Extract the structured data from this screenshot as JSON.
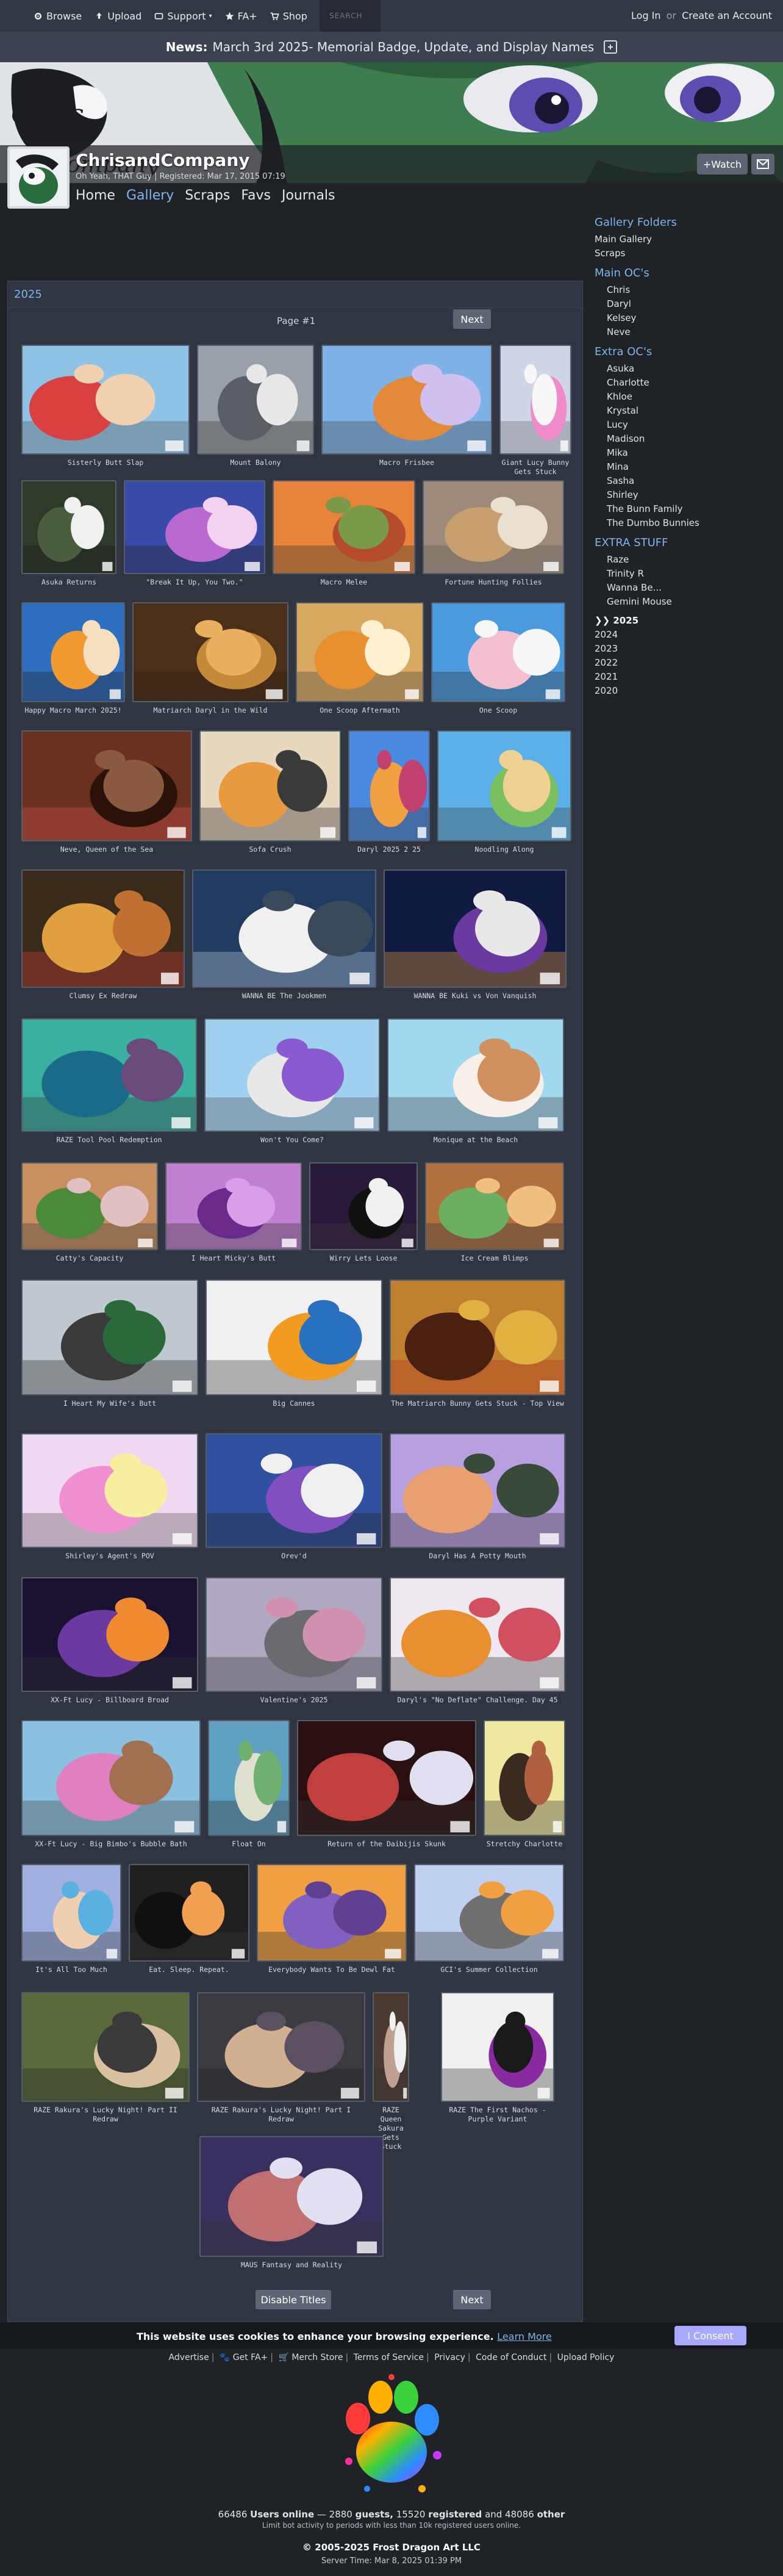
{
  "topbar": {
    "browse": "Browse",
    "upload": "Upload",
    "support": "Support",
    "fa_plus": "FA+",
    "shop": "Shop",
    "search_placeholder": "SEARCH",
    "login": "Log In",
    "or": "or",
    "create_account": "Create an Account"
  },
  "news": {
    "label": "News:",
    "text": "March 3rd 2025- Memorial Badge, Update, and Display Names"
  },
  "profile": {
    "username": "ChrisandCompany",
    "meta": "Oh Yeah, THAT Guy | Registered: Mar 17, 2015 07:19",
    "watch_label": "+Watch",
    "tabs": [
      "Home",
      "Gallery",
      "Scraps",
      "Favs",
      "Journals"
    ]
  },
  "sidebar": {
    "heading_folders": "Gallery Folders",
    "top_links": [
      "Main Gallery",
      "Scraps"
    ],
    "sections": [
      {
        "title": "Main OC's",
        "items": [
          "Chris",
          "Daryl",
          "Kelsey",
          "Neve"
        ]
      },
      {
        "title": "Extra OC's",
        "items": [
          "Asuka",
          "Charlotte",
          "Khloe",
          "Krystal",
          "Lucy",
          "Madison",
          "Mika",
          "Mina",
          "Sasha",
          "Shirley",
          "The Bunn Family",
          "The Dumbo Bunnies"
        ]
      },
      {
        "title": "EXTRA STUFF",
        "items": [
          "Raze",
          "Trinity R",
          "Wanna Be...",
          "Gemini Mouse"
        ]
      }
    ],
    "years": [
      "2025",
      "2024",
      "2023",
      "2022",
      "2021",
      "2020"
    ],
    "current_year_marker": "❯❯"
  },
  "gallery": {
    "heading": "2025",
    "page_label": "Page #1",
    "next_label": "Next",
    "disable_titles_label": "Disable Titles",
    "thumbs": [
      {
        "title": "Sisterly Butt Slap"
      },
      {
        "title": "Mount Balony"
      },
      {
        "title": "Macro Frisbee"
      },
      {
        "title": "Giant Lucy Bunny Gets Stuck"
      },
      {
        "title": "Asuka Returns"
      },
      {
        "title": "\"Break It Up, You Two.\""
      },
      {
        "title": "Macro Melee"
      },
      {
        "title": "Fortune Hunting Follies"
      },
      {
        "title": "Happy Macro March 2025!"
      },
      {
        "title": "Matriarch Daryl in the Wild"
      },
      {
        "title": "One Scoop Aftermath"
      },
      {
        "title": "One Scoop"
      },
      {
        "title": "Neve, Queen of the Sea"
      },
      {
        "title": "Sofa Crush"
      },
      {
        "title": "Daryl 2025 2 25"
      },
      {
        "title": "Noodling Along"
      },
      {
        "title": "Clumsy Ex Redraw"
      },
      {
        "title": "WANNA BE The Jookmen"
      },
      {
        "title": "WANNA BE Kuki vs Von Vanquish"
      },
      {
        "title": "RAZE Tool Pool Redemption"
      },
      {
        "title": "Won't You Come?"
      },
      {
        "title": "Monique at the Beach"
      },
      {
        "title": "Catty's Capacity"
      },
      {
        "title": "I Heart Micky's Butt"
      },
      {
        "title": "Wirry Lets Loose"
      },
      {
        "title": "Ice Cream Blimps"
      },
      {
        "title": "I Heart My Wife's Butt"
      },
      {
        "title": "Big Cannes"
      },
      {
        "title": "The Matriarch Bunny Gets Stuck - Top View"
      },
      {
        "title": "Shirley's Agent's POV"
      },
      {
        "title": "Orev'd"
      },
      {
        "title": "Daryl Has A Potty Mouth"
      },
      {
        "title": "XX-Ft Lucy - Billboard Broad"
      },
      {
        "title": "Valentine's 2025"
      },
      {
        "title": "Daryl's \"No Deflate\" Challenge. Day 45"
      },
      {
        "title": "XX-Ft Lucy - Big Bimbo's Bubble Bath"
      },
      {
        "title": "Float On"
      },
      {
        "title": "Return of the Daibijis Skunk"
      },
      {
        "title": "Stretchy Charlotte"
      },
      {
        "title": "It's All Too Much"
      },
      {
        "title": "Eat. Sleep. Repeat."
      },
      {
        "title": "Everybody Wants To Be Dewl Fat"
      },
      {
        "title": "GCI's Summer Collection"
      },
      {
        "title": "RAZE Rakura's Lucky Night! Part II Redraw"
      },
      {
        "title": "RAZE Rakura's Lucky Night! Part I Redraw"
      },
      {
        "title": "RAZE Queen Sakura Gets Stuck"
      },
      {
        "title": "RAZE The First Nachos - Purple Variant"
      },
      {
        "title": "MAUS Fantasy and Reality"
      }
    ]
  },
  "cookie": {
    "text": "This website uses cookies to enhance your browsing experience.",
    "learn_more": "Learn More",
    "consent": "I Consent"
  },
  "footer": {
    "links": [
      "Advertise",
      "Get FA+",
      "Merch Store",
      "Terms of Service",
      "Privacy",
      "Code of Conduct",
      "Upload Policy"
    ],
    "online_count": "66486",
    "online_label": "Users online",
    "guests": "2880",
    "guests_label": "guests,",
    "registered": "15520",
    "registered_label": "registered",
    "and": "and",
    "other": "48086",
    "other_label": "other",
    "limit_note": "Limit bot activity to periods with less than 10k registered users online.",
    "copyright": "© 2005-2025 Frost Dragon Art LLC",
    "server_time": "Server Time: Mar 8, 2025 01:39 PM"
  },
  "colors": {
    "accent": "#7fb6e8",
    "panel": "#2f3541",
    "page_bg": "#1f2227",
    "consent_button": "#a8a8ff"
  }
}
